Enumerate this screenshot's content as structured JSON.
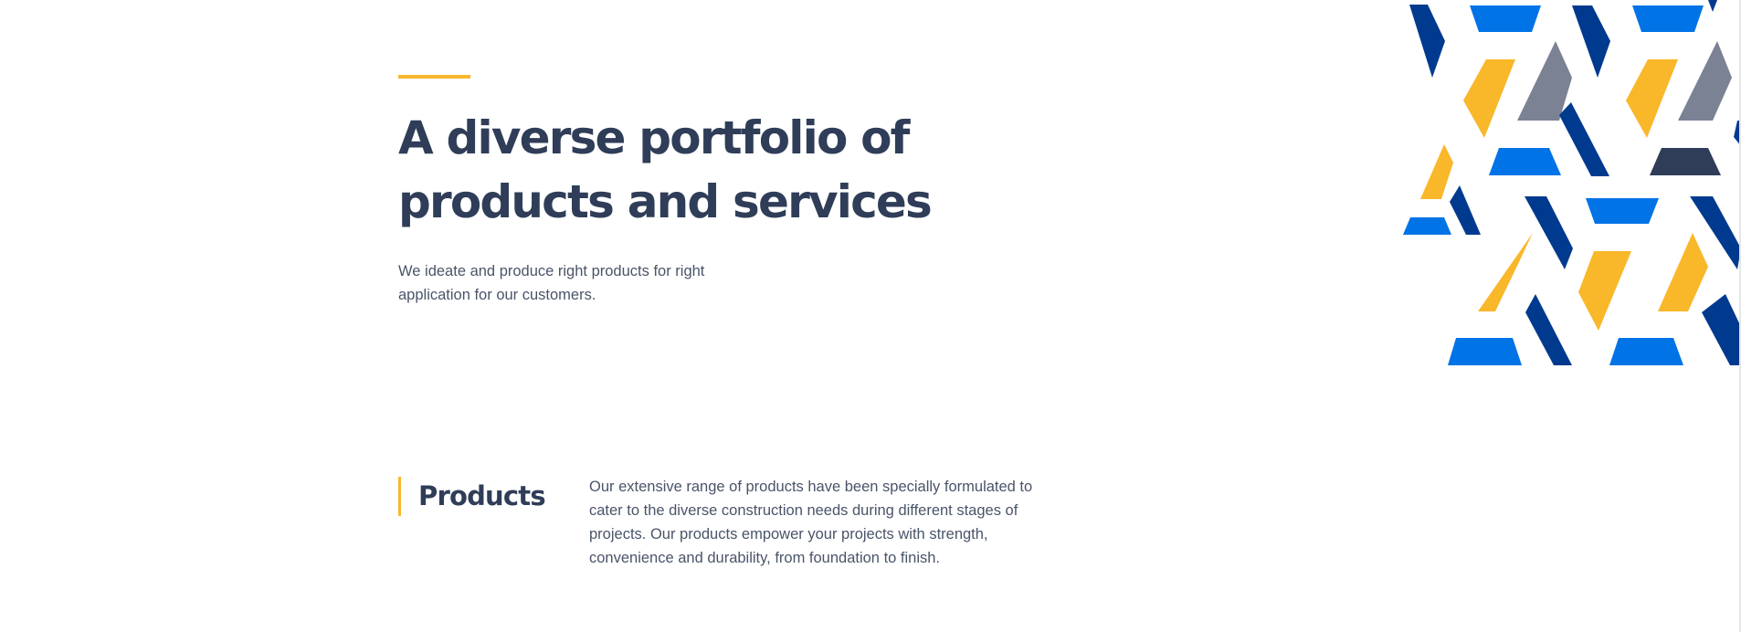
{
  "hero": {
    "title_line_1": "A diverse portfolio of",
    "title_line_2": "products and services",
    "subtitle": "We ideate and produce right products for right application for our customers."
  },
  "products": {
    "heading": "Products",
    "description": "Our extensive range of products have been specially formulated to cater to the diverse construction needs during different stages of projects. Our products empower your projects with strength, convenience and durability, from foundation to finish."
  },
  "colors": {
    "heading": "#2f3d58",
    "body_text": "#4a5469",
    "accent": "#f9b72a",
    "pattern_navy": "#003a8f",
    "pattern_blue": "#0073e6",
    "pattern_gray": "#7b8294",
    "pattern_dark": "#2f3d58",
    "pattern_yellow": "#f9b72a"
  }
}
